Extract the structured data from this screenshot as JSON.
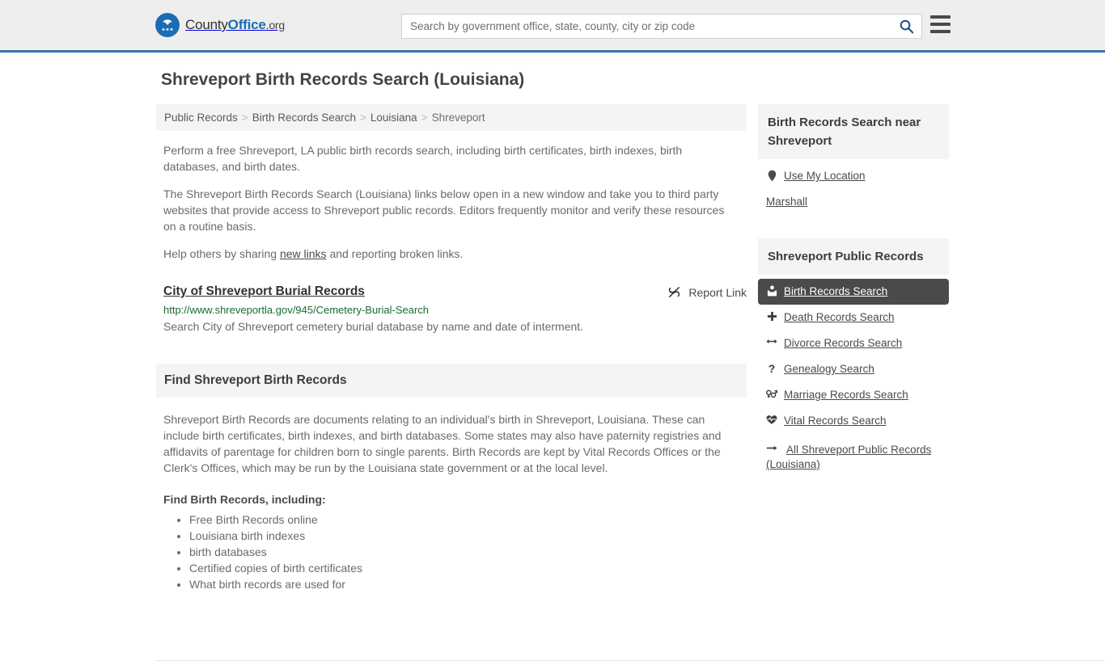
{
  "header": {
    "brand_name_1": "County",
    "brand_name_2": "Office",
    "brand_name_3": ".org",
    "search_placeholder": "Search by government office, state, county, city or zip code",
    "search_value": "",
    "search_icon": "search-icon",
    "menu_icon": "hamburger-menu-icon"
  },
  "page": {
    "title": "Shreveport Birth Records Search (Louisiana)"
  },
  "breadcrumb": {
    "items": [
      {
        "label": "Public Records",
        "current": false
      },
      {
        "label": "Birth Records Search",
        "current": false
      },
      {
        "label": "Louisiana",
        "current": false
      },
      {
        "label": "Shreveport",
        "current": true
      }
    ],
    "separator": ">"
  },
  "intro": {
    "paragraph_1": "Perform a free Shreveport, LA public birth records search, including birth certificates, birth indexes, birth databases, and birth dates.",
    "paragraph_2": "The Shreveport Birth Records Search (Louisiana) links below open in a new window and take you to third party websites that provide access to Shreveport public records. Editors frequently monitor and verify these resources on a routine basis.",
    "paragraph_3_before": "Help others by sharing ",
    "paragraph_3_link": "new links",
    "paragraph_3_after": " and reporting broken links."
  },
  "result": {
    "title": "City of Shreveport Burial Records",
    "url": "http://www.shreveportla.gov/945/Cemetery-Burial-Search",
    "description": "Search City of Shreveport cemetery burial database by name and date of interment.",
    "report_label": "Report Link",
    "report_icon": "broken-link-icon"
  },
  "find_section": {
    "heading": "Find Shreveport Birth Records",
    "body": "Shreveport Birth Records are documents relating to an individual's birth in Shreveport, Louisiana. These can include birth certificates, birth indexes, and birth databases. Some states may also have paternity registries and affidavits of parentage for children born to single parents. Birth Records are kept by Vital Records Offices or the Clerk's Offices, which may be run by the Louisiana state government or at the local level.",
    "sub_heading": "Find Birth Records, including:",
    "bullets": [
      "Free Birth Records online",
      "Louisiana birth indexes",
      "birth databases",
      "Certified copies of birth certificates",
      "What birth records are used for"
    ]
  },
  "sidebar": {
    "near_section": {
      "heading": "Birth Records Search near Shreveport",
      "links": [
        {
          "label": "Use My Location",
          "icon": "map-pin-icon",
          "has_icon": true
        },
        {
          "label": "Marshall",
          "icon": "",
          "has_icon": false
        }
      ]
    },
    "public_records_section": {
      "heading": "Shreveport Public Records",
      "links": [
        {
          "label": "Birth Records Search",
          "icon": "baby-icon",
          "active": true
        },
        {
          "label": "Death Records Search",
          "icon": "cross-icon",
          "active": false
        },
        {
          "label": "Divorce Records Search",
          "icon": "arrows-split-icon",
          "active": false
        },
        {
          "label": "Genealogy Search",
          "icon": "question-mark-icon",
          "active": false
        },
        {
          "label": "Marriage Records Search",
          "icon": "gender-symbols-icon",
          "active": false
        },
        {
          "label": "Vital Records Search",
          "icon": "heartbeat-icon",
          "active": false
        },
        {
          "label": "All Shreveport Public Records (Louisiana)",
          "icon": "arrow-right-icon",
          "active": false
        }
      ]
    }
  },
  "colors": {
    "brand_blue": "#1b6cb5",
    "header_border": "#3a72a8",
    "url_green": "#1b6b2f",
    "active_bg": "#4a4a4a",
    "panel_gray": "#f4f4f4"
  }
}
